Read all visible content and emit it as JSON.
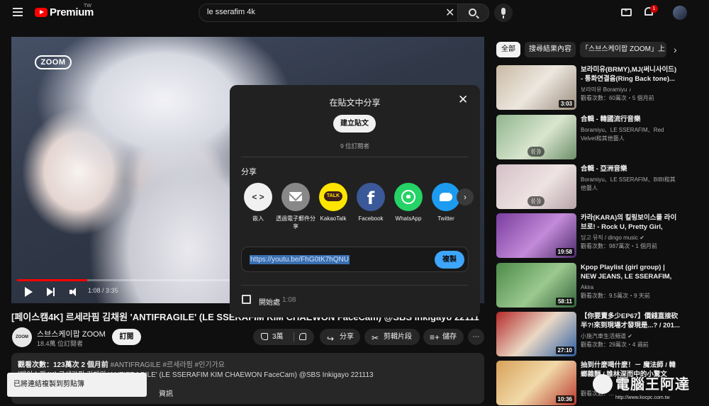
{
  "header": {
    "logo_text": "Premium",
    "logo_region": "TW",
    "search_value": "le sserafim 4k",
    "notification_count": "1",
    "clear_glyph": "✕"
  },
  "player": {
    "overlay_logo": "ZOOM",
    "time": "1:08 / 3:35",
    "progress": 0.32
  },
  "video": {
    "title": "[페이스캠4K] 르세라핌 김채원 'ANTIFRAGILE' (LE SSERAFIM KIM CHAEWON FaceCam) @SBS Inkigayo 221113",
    "channel_name": "스브스케이팝 ZOOM",
    "channel_avatar_text": "ZOOM",
    "subscribers": "18.4萬 位訂閱者",
    "subscribe_label": "訂閱",
    "likes": "3萬",
    "share_label": "分享",
    "clip_label": "剪輯片段",
    "save_label": "儲存",
    "more_label": "⋯",
    "desc_stats": "觀看次數：123萬次  2 個月前",
    "desc_tags": "#ANTIFRAGILE #르세라핌 #인기가요",
    "desc_line": "[페이스캠4K] 르세라핌 김채원 'ANTIFRAGILE' (LE SSERAFIM KIM CHAEWON FaceCam) @SBS Inkigayo 221113",
    "desc_more": "資訊"
  },
  "toast": {
    "text": "已將連結複製到剪貼簿"
  },
  "chips": [
    "全部",
    "搜尋結果內容",
    "「스브스케이팝 ZOOM」上"
  ],
  "recommendations": [
    {
      "title": "보라미유(BRMY),MJ(써니사이드) - 통화연결음(Ring Back tone)...",
      "channel": "보라미유 Boramiyu ♪",
      "meta": "觀看次數：60萬次・5 個月前",
      "duration": "3:03",
      "live": ""
    },
    {
      "title": "合輯 - 韓國流行音樂",
      "channel": "Boramiyu、LE SSERAFIM、Red Velvet和其他藝人",
      "meta": "",
      "duration": "",
      "live": "((·))"
    },
    {
      "title": "合輯 - 亞洲音樂",
      "channel": "Boramiyu、LE SSERAFIM、BIBI和其他藝人",
      "meta": "",
      "duration": "",
      "live": "((·))"
    },
    {
      "title": "카라(KARA)의 킬링보이스를 라이브로! - Rock U, Pretty Girl, Honey,...",
      "channel": "딩고 뮤직 / dingo music ✔",
      "meta": "觀看次數：987萬次・1 個月前",
      "duration": "19:58",
      "live": ""
    },
    {
      "title": "Kpop Playlist (girl group) | NEW JEANS, LE SSERAFIM, IVE |...",
      "channel": "Akira",
      "meta": "觀看次數：9.5萬次・9 天前",
      "duration": "58:11",
      "live": ""
    },
    {
      "title": "【你要賣多少EP67】價錢直接砍半?!來到現場才發現是...? / 201...",
      "channel": "小施汽車生活頻道 ✔",
      "meta": "觀看次數：29萬次・4 週前",
      "duration": "27:10",
      "live": ""
    },
    {
      "title": "抽到什麼喝什麼！－ 魔法師 / 韓螂雜麵 / 誰林深而中的小驚文",
      "channel": "",
      "meta": "觀看次數：...",
      "duration": "10:36",
      "live": ""
    }
  ],
  "modal": {
    "title": "在貼文中分享",
    "close_glyph": "✕",
    "create_post": "建立貼文",
    "subs": "9 位訂閱者",
    "share_heading": "分享",
    "targets": [
      {
        "label": "嵌入",
        "icon": "embed-icon"
      },
      {
        "label": "透過電子郵件分享",
        "icon": "email-icon"
      },
      {
        "label": "KakaoTalk",
        "icon": "kakaotalk-icon"
      },
      {
        "label": "Facebook",
        "icon": "facebook-icon"
      },
      {
        "label": "WhatsApp",
        "icon": "whatsapp-icon"
      },
      {
        "label": "Twitter",
        "icon": "twitter-icon"
      }
    ],
    "link": "https://youtu.be/FhG0tK7hQNU",
    "copy_label": "複製",
    "start_label": "開始處",
    "start_time": "1:08"
  },
  "watermark": {
    "text": "電腦王阿達",
    "url": "http://www.kocpc.com.tw"
  },
  "colors": {
    "accent": "#ff0000",
    "link_blue": "#3ea6ff",
    "background": "#0f0f0f"
  }
}
